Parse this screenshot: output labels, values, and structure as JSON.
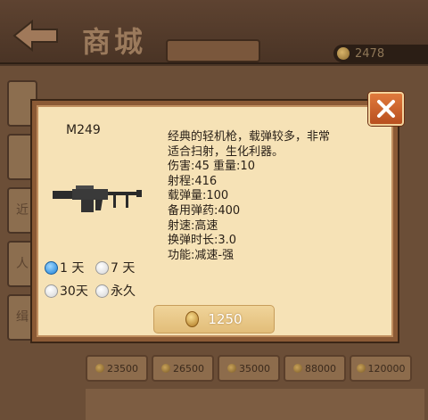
{
  "background": {
    "title": "商城",
    "coin_balance": "2478",
    "sidebar_tabs": [
      "",
      "",
      "近",
      "人",
      "缉"
    ],
    "prices": [
      "23500",
      "26500",
      "35000",
      "88000",
      "120000"
    ]
  },
  "dialog": {
    "item_name": "M249",
    "description_lines": [
      "经典的轻机枪，载弹较多，非常",
      "适合扫射，生化利器。",
      "伤害:45 重量:10",
      "射程:416",
      "载弹量:100",
      "备用弹药:400",
      "射速:高速",
      "换弹时长:3.0",
      "功能:减速-强"
    ],
    "duration_options": [
      {
        "label": "1 天",
        "selected": true
      },
      {
        "label": "7 天",
        "selected": false
      },
      {
        "label": "30天",
        "selected": false
      },
      {
        "label": "永久",
        "selected": false
      }
    ],
    "price": "1250",
    "icons": {
      "close": "close-x-icon",
      "coin": "gold-coin-icon",
      "weapon": "machine-gun-icon",
      "back": "back-arrow-icon"
    }
  }
}
